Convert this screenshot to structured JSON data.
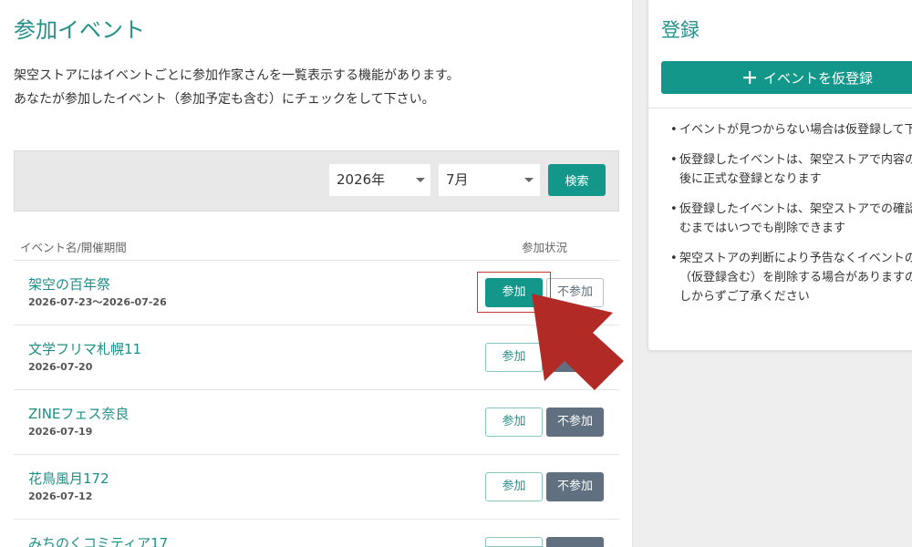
{
  "page": {
    "title": "参加イベント",
    "description": [
      "架空ストアにはイベントごとに参加作家さんを一覧表示する機能があります。",
      "あなたが参加したイベント（参加予定も含む）にチェックをして下さい。"
    ]
  },
  "search": {
    "year": "2026年",
    "month": "7月",
    "button_label": "検索",
    "caret_icon": "caret-down-icon"
  },
  "table": {
    "header_name": "イベント名/開催期間",
    "header_status": "参加状況",
    "rows": [
      {
        "name": "架空の百年祭",
        "period": "2026-07-23～2026-07-26",
        "join_label": "参加",
        "decline_label": "不参加",
        "joined": true
      },
      {
        "name": "文学フリマ札幌11",
        "period": "2026-07-20",
        "join_label": "参加",
        "joined": false
      },
      {
        "name": "ZINEフェス奈良",
        "period": "2026-07-19",
        "join_label": "参加",
        "decline_label": "不参加",
        "joined": false
      },
      {
        "name": "花鳥風月172",
        "period": "2026-07-12",
        "join_label": "参加",
        "decline_label": "不参加",
        "joined": false
      },
      {
        "name": "みちのくコミティア17",
        "joined": false
      }
    ]
  },
  "register": {
    "title": "登録",
    "add_button": {
      "icon": "plus-icon",
      "label": "イベントを仮登録"
    },
    "notes": [
      [
        "イベントが見つからない場合は仮登録して下"
      ],
      [
        "仮登録したイベントは、架空ストアで内容の",
        "後に正式な登録となります"
      ],
      [
        "仮登録したイベントは、架空ストアでの確認",
        "むまではいつでも削除できます"
      ],
      [
        "架空ストアの判断により予告なくイベントの",
        "（仮登録含む）を削除する場合がありますの",
        "しからずご了承ください"
      ]
    ]
  },
  "colors": {
    "accent": "#13978a",
    "title": "#23908a",
    "link": "#1b8f87",
    "decline_active": "#607080",
    "annotation": "#b22a26"
  }
}
